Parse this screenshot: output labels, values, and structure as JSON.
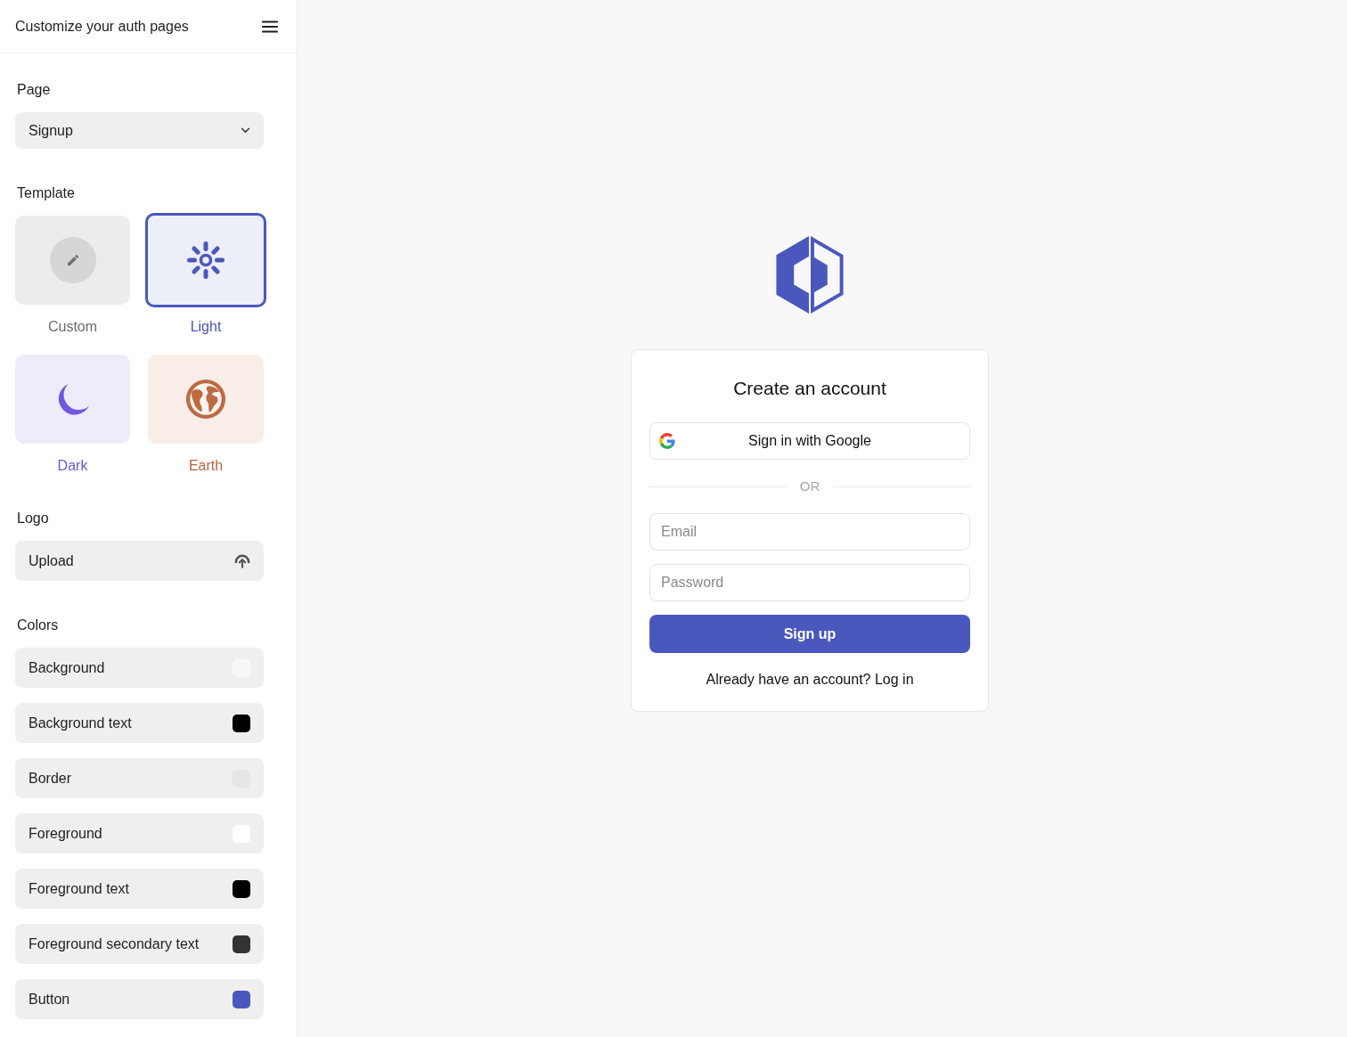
{
  "sidebar": {
    "title": "Customize your auth pages",
    "page": {
      "label": "Page",
      "select": {
        "value": "Signup"
      }
    },
    "template": {
      "label": "Template",
      "options": [
        {
          "kind": "custom",
          "label": "Custom",
          "selected": false
        },
        {
          "kind": "light",
          "label": "Light",
          "selected": true
        },
        {
          "kind": "dark",
          "label": "Dark",
          "selected": false
        },
        {
          "kind": "earth",
          "label": "Earth",
          "selected": false
        }
      ]
    },
    "logo": {
      "label": "Logo",
      "upload": {
        "label": "Upload"
      }
    },
    "colors": {
      "label": "Colors",
      "items": [
        {
          "label": "Background",
          "color": "#f8f8f8"
        },
        {
          "label": "Background text",
          "color": "#000000"
        },
        {
          "label": "Border",
          "color": "#e6e6e6"
        },
        {
          "label": "Foreground",
          "color": "#ffffff"
        },
        {
          "label": "Foreground text",
          "color": "#000000"
        },
        {
          "label": "Foreground secondary text",
          "color": "#333333"
        },
        {
          "label": "Button",
          "color": "#4a58bd"
        }
      ]
    }
  },
  "preview": {
    "heading": "Create an account",
    "google_button": {
      "label": "Sign in with Google"
    },
    "divider": "OR",
    "email": {
      "placeholder": "Email"
    },
    "password": {
      "placeholder": "Password"
    },
    "submit": {
      "label": "Sign up"
    },
    "footer": "Already have an account? Log in"
  }
}
